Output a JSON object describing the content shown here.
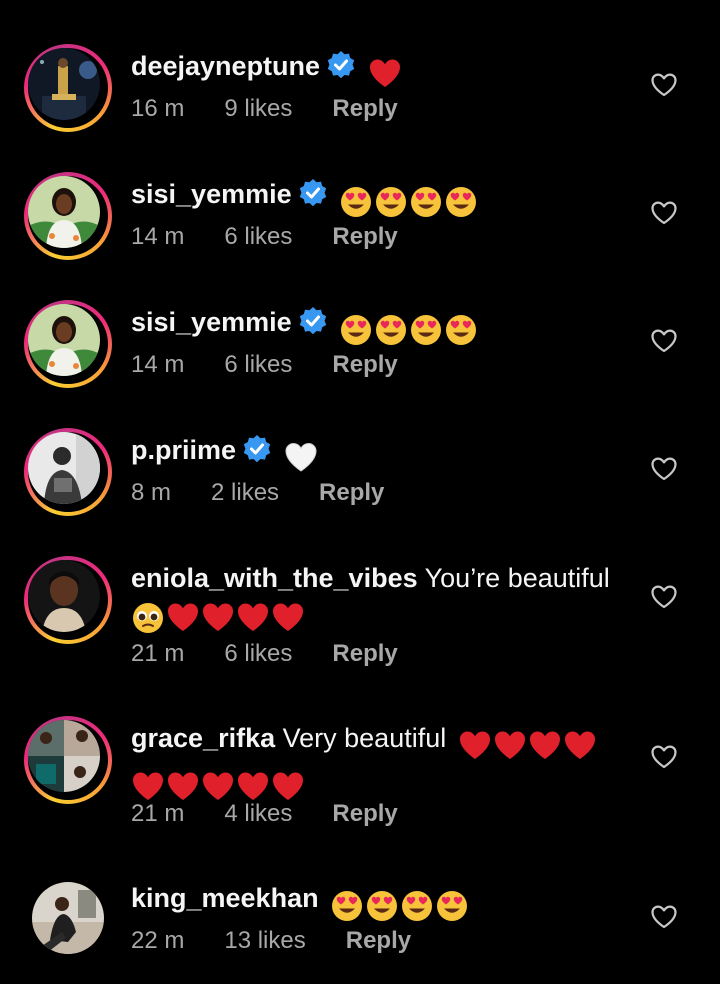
{
  "comments": [
    {
      "username": "deejayneptune",
      "verified": true,
      "text": "",
      "emojis": [
        "red-heart"
      ],
      "time": "16 m",
      "likes": "9 likes",
      "reply": "Reply",
      "avatar": "dj-night-avatar",
      "ring": true
    },
    {
      "username": "sisi_yemmie",
      "verified": true,
      "text": "",
      "emojis": [
        "heart-eyes",
        "heart-eyes",
        "heart-eyes",
        "heart-eyes"
      ],
      "time": "14 m",
      "likes": "6 likes",
      "reply": "Reply",
      "avatar": "woman-green-avatar",
      "ring": true
    },
    {
      "username": "sisi_yemmie",
      "verified": true,
      "text": "",
      "emojis": [
        "heart-eyes",
        "heart-eyes",
        "heart-eyes",
        "heart-eyes"
      ],
      "time": "14 m",
      "likes": "6 likes",
      "reply": "Reply",
      "avatar": "woman-green-avatar",
      "ring": true
    },
    {
      "username": "p.priime",
      "verified": true,
      "text": "",
      "emojis": [
        "white-heart"
      ],
      "time": "8 m",
      "likes": "2 likes",
      "reply": "Reply",
      "avatar": "man-bw-avatar",
      "ring": true
    },
    {
      "username": "eniola_with_the_vibes",
      "verified": false,
      "text": "You’re beautiful",
      "emojis": [
        "pleading-face",
        "red-heart",
        "red-heart",
        "red-heart",
        "red-heart"
      ],
      "time": "21 m",
      "likes": "6 likes",
      "reply": "Reply",
      "avatar": "woman-dark-avatar",
      "ring": true
    },
    {
      "username": "grace_rifka",
      "verified": false,
      "text": "Very beautiful",
      "emojis": [
        "red-heart",
        "red-heart",
        "red-heart",
        "red-heart",
        "red-heart",
        "red-heart",
        "red-heart",
        "red-heart",
        "red-heart"
      ],
      "time": "21 m",
      "likes": "4 likes",
      "reply": "Reply",
      "avatar": "collage-avatar",
      "ring": true
    },
    {
      "username": "king_meekhan",
      "verified": false,
      "text": "",
      "emojis": [
        "heart-eyes",
        "heart-eyes",
        "heart-eyes",
        "heart-eyes"
      ],
      "time": "22 m",
      "likes": "13 likes",
      "reply": "Reply",
      "avatar": "man-outdoor-avatar",
      "ring": false
    }
  ],
  "colors": {
    "background": "#000000",
    "text": "#f5f5f5",
    "meta": "#a8a8a8",
    "verified": "#3897f0",
    "heart": "#e0202a"
  }
}
